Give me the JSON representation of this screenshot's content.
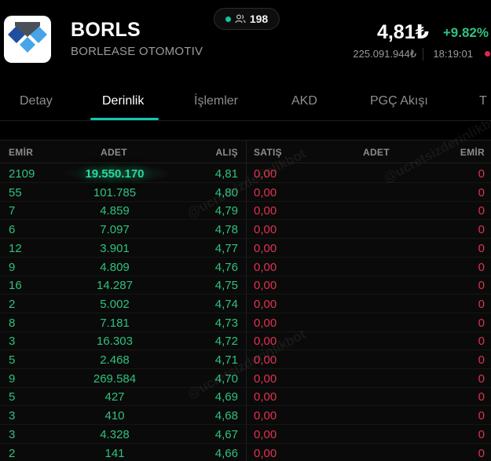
{
  "stock": {
    "ticker": "BORLS",
    "company": "BORLEASE OTOMOTIV",
    "viewers": "198",
    "price": "4,81₺",
    "change": "+9.82%",
    "volume": "225.091.944₺",
    "time": "18:19:01"
  },
  "tabs": [
    {
      "label": "Detay"
    },
    {
      "label": "Derinlik"
    },
    {
      "label": "İşlemler"
    },
    {
      "label": "AKD"
    },
    {
      "label": "PGÇ Akışı"
    },
    {
      "label": "T"
    }
  ],
  "book": {
    "headers": {
      "bid_orders": "EMİR",
      "bid_qty": "ADET",
      "bid_price": "ALIŞ",
      "ask_price": "SATIŞ",
      "ask_qty": "ADET",
      "ask_orders": "EMİR"
    },
    "rows": [
      {
        "bid_orders": "2109",
        "bid_qty": "19.550.170",
        "bid_price": "4,81",
        "ask_price": "0,00",
        "ask_qty": "",
        "ask_orders": "0"
      },
      {
        "bid_orders": "55",
        "bid_qty": "101.785",
        "bid_price": "4,80",
        "ask_price": "0,00",
        "ask_qty": "",
        "ask_orders": "0"
      },
      {
        "bid_orders": "7",
        "bid_qty": "4.859",
        "bid_price": "4,79",
        "ask_price": "0,00",
        "ask_qty": "",
        "ask_orders": "0"
      },
      {
        "bid_orders": "6",
        "bid_qty": "7.097",
        "bid_price": "4,78",
        "ask_price": "0,00",
        "ask_qty": "",
        "ask_orders": "0"
      },
      {
        "bid_orders": "12",
        "bid_qty": "3.901",
        "bid_price": "4,77",
        "ask_price": "0,00",
        "ask_qty": "",
        "ask_orders": "0"
      },
      {
        "bid_orders": "9",
        "bid_qty": "4.809",
        "bid_price": "4,76",
        "ask_price": "0,00",
        "ask_qty": "",
        "ask_orders": "0"
      },
      {
        "bid_orders": "16",
        "bid_qty": "14.287",
        "bid_price": "4,75",
        "ask_price": "0,00",
        "ask_qty": "",
        "ask_orders": "0"
      },
      {
        "bid_orders": "2",
        "bid_qty": "5.002",
        "bid_price": "4,74",
        "ask_price": "0,00",
        "ask_qty": "",
        "ask_orders": "0"
      },
      {
        "bid_orders": "8",
        "bid_qty": "7.181",
        "bid_price": "4,73",
        "ask_price": "0,00",
        "ask_qty": "",
        "ask_orders": "0"
      },
      {
        "bid_orders": "3",
        "bid_qty": "16.303",
        "bid_price": "4,72",
        "ask_price": "0,00",
        "ask_qty": "",
        "ask_orders": "0"
      },
      {
        "bid_orders": "5",
        "bid_qty": "2.468",
        "bid_price": "4,71",
        "ask_price": "0,00",
        "ask_qty": "",
        "ask_orders": "0"
      },
      {
        "bid_orders": "9",
        "bid_qty": "269.584",
        "bid_price": "4,70",
        "ask_price": "0,00",
        "ask_qty": "",
        "ask_orders": "0"
      },
      {
        "bid_orders": "5",
        "bid_qty": "427",
        "bid_price": "4,69",
        "ask_price": "0,00",
        "ask_qty": "",
        "ask_orders": "0"
      },
      {
        "bid_orders": "3",
        "bid_qty": "410",
        "bid_price": "4,68",
        "ask_price": "0,00",
        "ask_qty": "",
        "ask_orders": "0"
      },
      {
        "bid_orders": "3",
        "bid_qty": "4.328",
        "bid_price": "4,67",
        "ask_price": "0,00",
        "ask_qty": "",
        "ask_orders": "0"
      },
      {
        "bid_orders": "2",
        "bid_qty": "141",
        "bid_price": "4,66",
        "ask_price": "0,00",
        "ask_qty": "",
        "ask_orders": "0"
      }
    ]
  },
  "watermark": "@ucretsizderinlikbot",
  "colors": {
    "background": "#000000",
    "bid_green": "#2ec27e",
    "ask_red": "#e0334f",
    "accent_teal": "#12c7b0",
    "muted_text": "#9a9a9a",
    "logo_dark_blue": "#1f4f9e",
    "logo_light_blue": "#47a4e8",
    "logo_gray": "#4a4f59"
  },
  "icons": {
    "logo": "borlease-logo",
    "viewers": "users-icon",
    "live": "live-dot-icon"
  }
}
